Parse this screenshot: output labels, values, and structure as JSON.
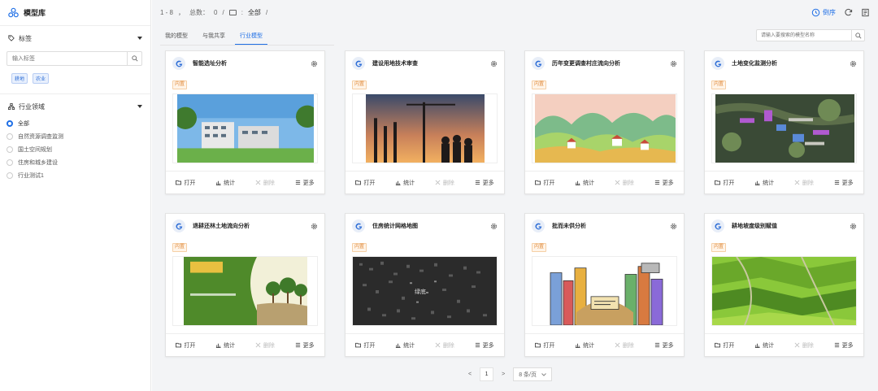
{
  "sidebar": {
    "title": "模型库",
    "tag_section": {
      "label": "标签"
    },
    "tag_search": {
      "placeholder": "输入标签"
    },
    "tags": [
      "耕地",
      "农业"
    ],
    "domain_section": {
      "label": "行业领域"
    },
    "domains": [
      {
        "label": "全部",
        "selected": true
      },
      {
        "label": "自然资源调查监测",
        "selected": false
      },
      {
        "label": "国土空间规划",
        "selected": false
      },
      {
        "label": "住房和城乡建设",
        "selected": false
      },
      {
        "label": "行业测试1",
        "selected": false
      }
    ]
  },
  "topbar": {
    "range": "1 - 8",
    "sep1": "，",
    "total_label": "总数：",
    "total": "0",
    "slash1": "/",
    "colon": ":",
    "folder_label": "全部",
    "slash2": "/",
    "sort_label": "倒序"
  },
  "tabs": [
    {
      "label": "我的模型",
      "active": false
    },
    {
      "label": "与我共享",
      "active": false
    },
    {
      "label": "行业模型",
      "active": true
    }
  ],
  "search": {
    "placeholder": "请输入要搜索的模型名称"
  },
  "cards": [
    {
      "title": "智能选址分析",
      "tag": "内置",
      "image": "building-photo"
    },
    {
      "title": "建设用地技术审查",
      "tag": "内置",
      "image": "construction-photo"
    },
    {
      "title": "历年变更调查村庄流向分析",
      "tag": "内置",
      "image": "village-illustration"
    },
    {
      "title": "土地变化监测分析",
      "tag": "内置",
      "image": "satellite-photo"
    },
    {
      "title": "退耕还林土地流向分析",
      "tag": "内置",
      "image": "forest-poster"
    },
    {
      "title": "住房统计网格地图",
      "tag": "内置",
      "image": "grid-map"
    },
    {
      "title": "批而未供分析",
      "tag": "内置",
      "image": "city-illustration"
    },
    {
      "title": "耕地坡度级别赋值",
      "tag": "内置",
      "image": "farmland-photo"
    }
  ],
  "card_actions": {
    "open": "打开",
    "stats": "统计",
    "delete": "删除",
    "more": "更多"
  },
  "grid_map_label": "绿底",
  "pagination": {
    "prev": "<",
    "page": "1",
    "next": ">",
    "page_size": "8 条/页"
  },
  "colors": {
    "accent": "#1f6fe6",
    "tag_orange": "#e08a3a",
    "tag_blue": "#2f6fd7"
  }
}
